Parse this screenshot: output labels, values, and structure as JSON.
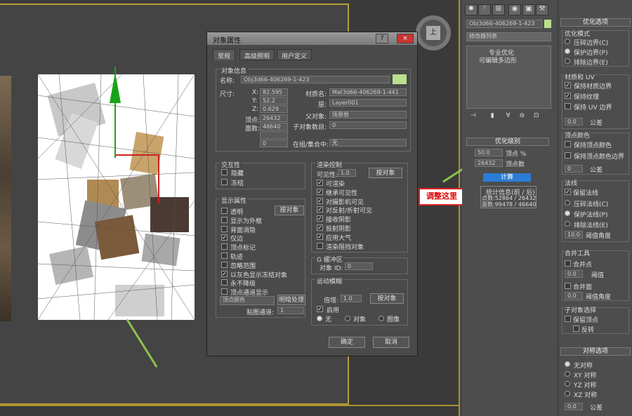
{
  "viewport": {
    "nav_cube_label": "上"
  },
  "dialog": {
    "title": "对象属性",
    "help": "?",
    "close": "×",
    "tabs": [
      "常规",
      "高级照明",
      "用户定义"
    ],
    "info": {
      "group": "对象信息",
      "name_label": "名称:",
      "name_value": "Obj3d66-406269-1-423",
      "color": "#b9e08e",
      "dims_label": "尺寸:",
      "x_label": "X:",
      "x": "82.595",
      "y_label": "Y:",
      "y": "52.2",
      "z_label": "Z:",
      "z": "0.629",
      "vertices_label": "顶点:",
      "vertices": "26432",
      "faces_label": "面数:",
      "faces": "46640",
      "material_label": "材质名:",
      "material": "Mat3d66-406269-1-441",
      "layer_label": "层:",
      "layer": "Layer001",
      "parent_label": "父对象:",
      "parent": "场景根",
      "children_label": "子对象数目:",
      "children": "0",
      "group_label": "在组/集合中:",
      "group_value": "无",
      "blank1": "",
      "blank2": "0"
    },
    "interactivity": {
      "title": "交互性",
      "hide": "隐藏",
      "freeze": "冻结"
    },
    "display": {
      "title": "显示属性",
      "by_object": "按对象",
      "items": [
        {
          "label": "透明",
          "checked": false
        },
        {
          "label": "显示为外框",
          "checked": false
        },
        {
          "label": "背面消隐",
          "checked": false
        },
        {
          "label": "仅边",
          "checked": true
        },
        {
          "label": "顶点标记",
          "checked": false
        },
        {
          "label": "轨迹",
          "checked": false
        },
        {
          "label": "忽略范围",
          "checked": false
        },
        {
          "label": "以灰色显示冻结对象",
          "checked": true
        },
        {
          "label": "永不降级",
          "checked": false
        },
        {
          "label": "顶点通道显示",
          "checked": false
        }
      ],
      "channel_select": "顶点颜色",
      "shaded_btn": "明暗处理",
      "map_channel_label": "贴图通道:",
      "map_channel": "1"
    },
    "render": {
      "title": "渲染控制",
      "visibility_label": "可见性:",
      "visibility": "1.0",
      "by_object": "按对象",
      "items": [
        {
          "label": "可渲染",
          "checked": true
        },
        {
          "label": "继承可见性",
          "checked": true
        },
        {
          "label": "对摄影机可见",
          "checked": true
        },
        {
          "label": "对反射/折射可见",
          "checked": true
        },
        {
          "label": "接收阴影",
          "checked": true
        },
        {
          "label": "投射阴影",
          "checked": true
        },
        {
          "label": "应用大气",
          "checked": true
        },
        {
          "label": "渲染阻挡对象",
          "checked": false
        }
      ]
    },
    "gbuffer": {
      "title": "G 缓冲区",
      "object_id_label": "对象 ID:",
      "object_id": "0"
    },
    "motion_blur": {
      "title": "运动模糊",
      "multiplier_label": "倍增:",
      "multiplier": "1.0",
      "by_object": "按对象",
      "enable": "启用",
      "options": [
        {
          "label": "无",
          "on": true
        },
        {
          "label": "对象",
          "on": false
        },
        {
          "label": "图像",
          "on": false
        }
      ]
    },
    "ok": "确定",
    "cancel": "取消"
  },
  "command_panel": {
    "object_name": "Obj3d66-406269-1-423",
    "object_color": "#b9e08e",
    "modifier_list": "修改器列表",
    "stack": [
      "专业优化",
      "可编辑多边形"
    ],
    "level_rollout": "优化级别",
    "vertex_pct_label": "顶点 %",
    "vertex_pct": "50.0",
    "vertex_count_label": "顶点数",
    "vertex_count": "26432",
    "calculate": "计算",
    "stats_title": "统计信息(前 / 后)",
    "stats_vertices": "点数:52864 / 26432",
    "stats_faces": "面数:99478 / 46640"
  },
  "highlight": {
    "label": "调整这里"
  },
  "options": {
    "title": "优化选项",
    "mode_title": "优化模式",
    "modes": [
      {
        "label": "压碎边界(C)",
        "on": false
      },
      {
        "label": "保护边界(P)",
        "on": true
      },
      {
        "label": "排除边界(E)",
        "on": false
      }
    ],
    "material_title": "材质和 UV",
    "material_items": [
      {
        "label": "保持材质边界",
        "checked": true
      },
      {
        "label": "保持纹理",
        "checked": true
      },
      {
        "label": "保持 UV 边界",
        "checked": false
      }
    ],
    "material_tol": "0.0",
    "tol_label": "公差",
    "vcolor_title": "顶点颜色",
    "vcolor_items": [
      {
        "label": "保持顶点颜色",
        "checked": false
      },
      {
        "label": "保持顶点颜色边界",
        "checked": false
      }
    ],
    "vcolor_tol": "0",
    "normals_title": "法线",
    "keep_normals": "保留法线",
    "normal_modes": [
      {
        "label": "压碎法线(C)",
        "on": false
      },
      {
        "label": "保护法线(P)",
        "on": true
      },
      {
        "label": "排除法线(E)",
        "on": false
      }
    ],
    "normal_angle": "10.0",
    "angle_label": "阈值角度",
    "merge_title": "合并工具",
    "merge_points": "合并点",
    "merge_point_val": "0.0",
    "threshold_label": "阈值",
    "merge_faces": "合并面",
    "merge_face_val": "0.0",
    "subobj_title": "子对象选择",
    "keep_vertices": "保留顶点",
    "invert": "反转",
    "sym_title": "对称选项",
    "sym": [
      {
        "label": "无对称",
        "on": true
      },
      {
        "label": "XY 对称",
        "on": false
      },
      {
        "label": "YZ 对称",
        "on": false
      },
      {
        "label": "XZ 对称",
        "on": false
      }
    ],
    "sym_tol": "0.0"
  }
}
